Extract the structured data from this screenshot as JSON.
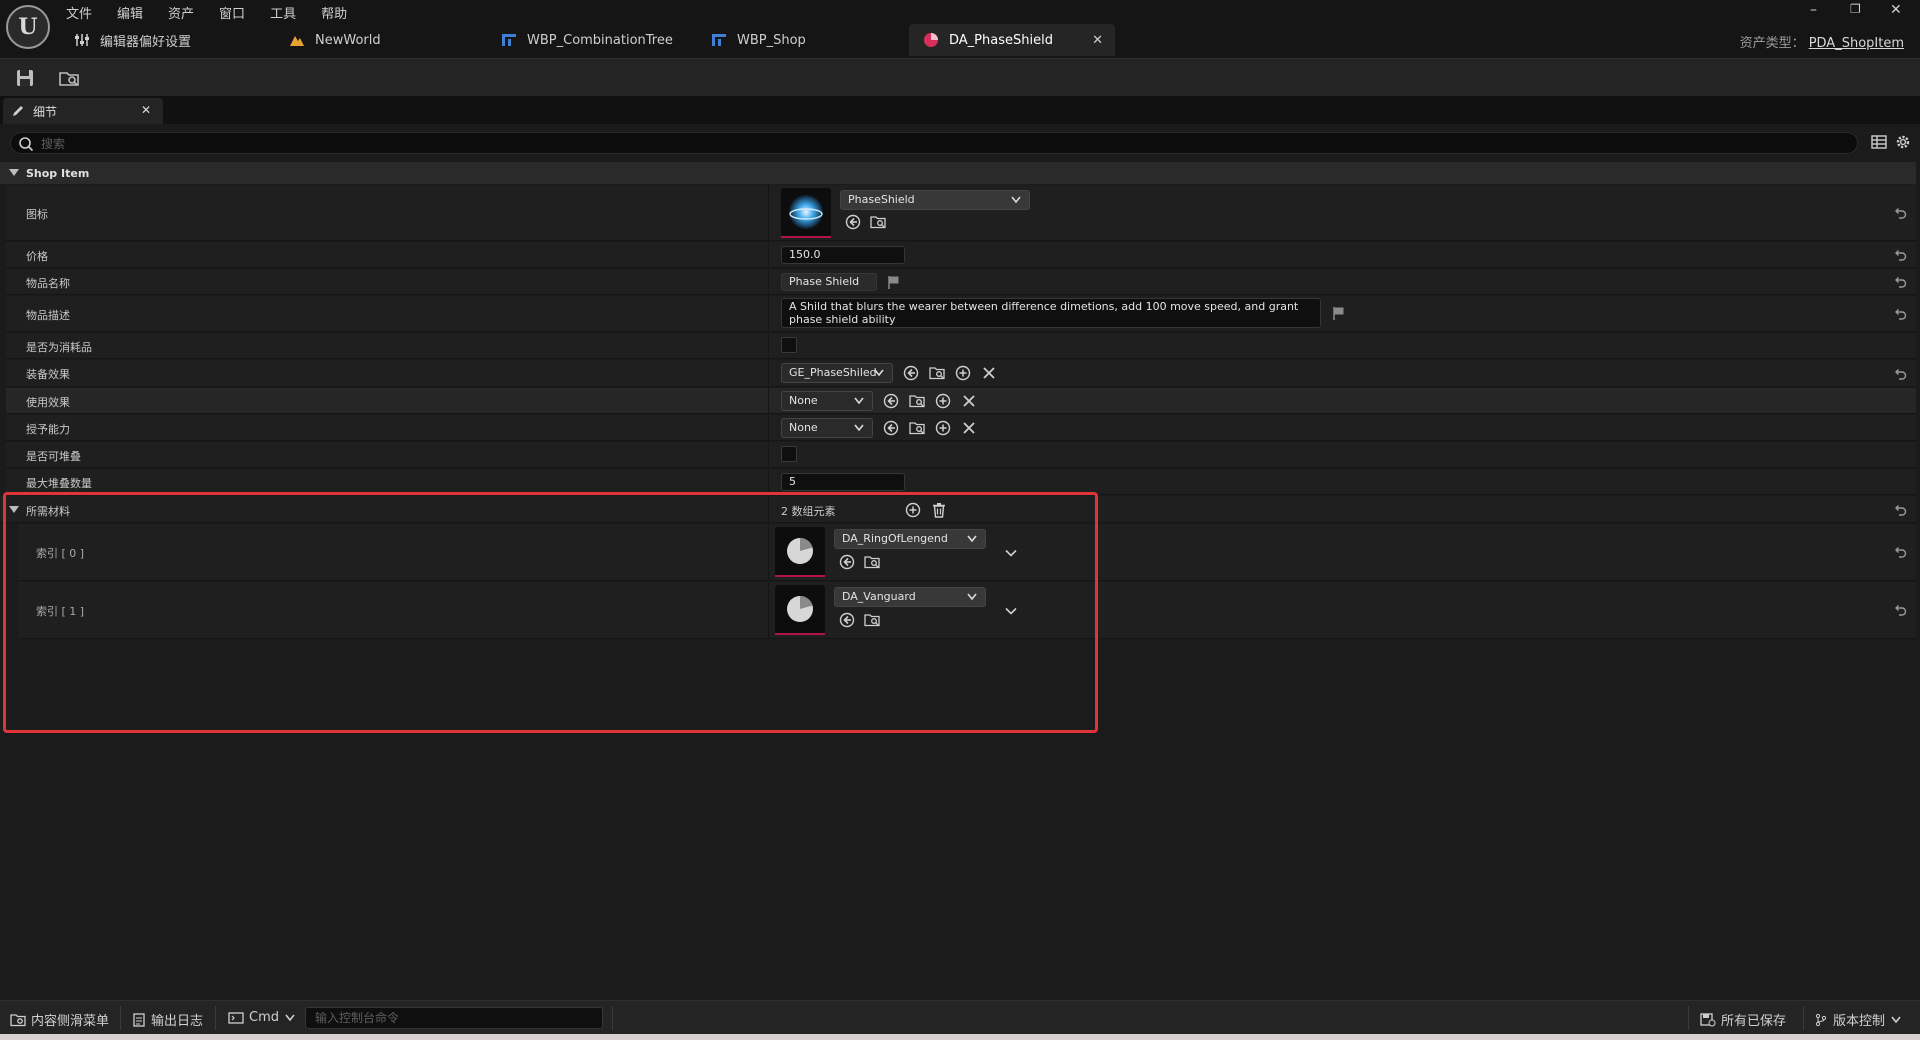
{
  "menu": [
    "文件",
    "编辑",
    "资产",
    "窗口",
    "工具",
    "帮助"
  ],
  "tabs": [
    {
      "label": "编辑器偏好设置",
      "icon": "sliders-icon"
    },
    {
      "label": "NewWorld",
      "icon": "level-icon"
    },
    {
      "label": "WBP_CombinationTree",
      "icon": "widget-blueprint-icon"
    },
    {
      "label": "WBP_Shop",
      "icon": "widget-blueprint-icon"
    },
    {
      "label": "DA_PhaseShield",
      "icon": "data-asset-icon",
      "active": true
    }
  ],
  "asset_type": {
    "label": "资产类型：",
    "value": "PDA_ShopItem"
  },
  "window_controls": [
    "–",
    "❐",
    "✕"
  ],
  "panel": {
    "tab_label": "细节",
    "close": "✕",
    "search_placeholder": "搜索"
  },
  "category": "Shop Item",
  "props": {
    "icon": {
      "label": "图标",
      "asset": "PhaseShield"
    },
    "price": {
      "label": "价格",
      "value": "150.0"
    },
    "name": {
      "label": "物品名称",
      "value": "Phase Shield"
    },
    "desc": {
      "label": "物品描述",
      "value": "A Shild that blurs the wearer between difference dimetions, add 100 move speed, and grant phase shield ability"
    },
    "consumable": {
      "label": "是否为消耗品",
      "checked": false
    },
    "equip_effect": {
      "label": "装备效果",
      "value": "GE_PhaseShiled"
    },
    "use_effect": {
      "label": "使用效果",
      "value": "None"
    },
    "grant_ability": {
      "label": "授予能力",
      "value": "None"
    },
    "stackable": {
      "label": "是否可堆叠",
      "checked": false
    },
    "max_stack": {
      "label": "最大堆叠数量",
      "value": "5"
    },
    "materials": {
      "label": "所需材料",
      "count_text": "2 数组元素",
      "items": [
        {
          "index_label": "索引 [ 0 ]",
          "asset": "DA_RingOfLengend"
        },
        {
          "index_label": "索引 [ 1 ]",
          "asset": "DA_Vanguard"
        }
      ]
    }
  },
  "status": {
    "content_drawer": "内容侧滑菜单",
    "output_log": "输出日志",
    "cmd": "Cmd",
    "console_placeholder": "输入控制台命令",
    "all_saved": "所有已保存",
    "source_control": "版本控制"
  },
  "colors": {
    "accent_pink": "#b0124a",
    "highlight_red": "#e0333a",
    "active_tab_icon": "#d6305a"
  }
}
